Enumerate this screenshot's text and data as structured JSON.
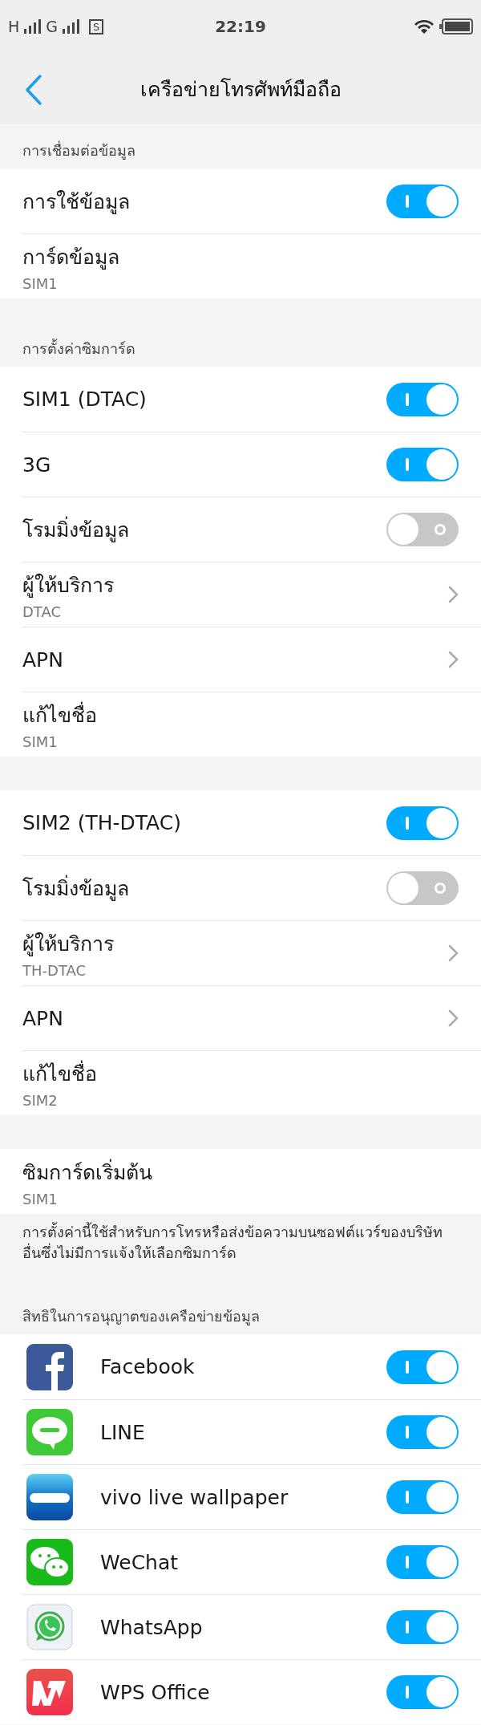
{
  "status_bar": {
    "network_1": "H",
    "network_2": "G",
    "screenshot_badge": "S",
    "time": "22:19"
  },
  "header": {
    "title": "เครือข่ายโทรศัพท์มือถือ"
  },
  "sections": [
    {
      "header": "การเชื่อมต่อข้อมูล",
      "rows": [
        {
          "kind": "toggle",
          "title": "การใช้ข้อมูล",
          "on": true
        },
        {
          "kind": "info",
          "title": "การ์ดข้อมูล",
          "subtitle": "SIM1"
        }
      ]
    },
    {
      "header": "การตั้งค่าซิมการ์ด",
      "rows": [
        {
          "kind": "toggle",
          "title": "SIM1 (DTAC)",
          "on": true
        },
        {
          "kind": "toggle",
          "title": "3G",
          "on": true
        },
        {
          "kind": "toggle",
          "title": "โรมมิ่งข้อมูล",
          "on": false
        },
        {
          "kind": "nav",
          "title": "ผู้ให้บริการ",
          "subtitle": "DTAC"
        },
        {
          "kind": "nav",
          "title": "APN"
        },
        {
          "kind": "info",
          "title": "แก้ไขชื่อ",
          "subtitle": "SIM1"
        }
      ]
    },
    {
      "rows": [
        {
          "kind": "toggle",
          "title": "SIM2 (TH-DTAC)",
          "on": true
        },
        {
          "kind": "toggle",
          "title": "โรมมิ่งข้อมูล",
          "on": false
        },
        {
          "kind": "nav",
          "title": "ผู้ให้บริการ",
          "subtitle": "TH-DTAC"
        },
        {
          "kind": "nav",
          "title": "APN"
        },
        {
          "kind": "info",
          "title": "แก้ไขชื่อ",
          "subtitle": "SIM2"
        }
      ]
    },
    {
      "rows": [
        {
          "kind": "info",
          "title": "ซิมการ์ดเริ่มต้น",
          "subtitle": "SIM1"
        }
      ],
      "note": "การตั้งค่านี้ใช้สำหรับการโทรหรือส่งข้อความบนซอฟต์แวร์ของบริษัทอื่นซึ่งไม่มีการแจ้งให้เลือกซิมการ์ด"
    },
    {
      "header": "สิทธิในการอนุญาตของเครือข่ายข้อมูล",
      "rows": [
        {
          "kind": "app",
          "title": "Facebook",
          "on": true
        },
        {
          "kind": "app",
          "title": "LINE",
          "on": true
        },
        {
          "kind": "app",
          "title": "vivo live wallpaper",
          "on": true
        },
        {
          "kind": "app",
          "title": "WeChat",
          "on": true
        },
        {
          "kind": "app",
          "title": "WhatsApp",
          "on": true
        },
        {
          "kind": "app",
          "title": "WPS Office",
          "on": true
        }
      ]
    }
  ]
}
